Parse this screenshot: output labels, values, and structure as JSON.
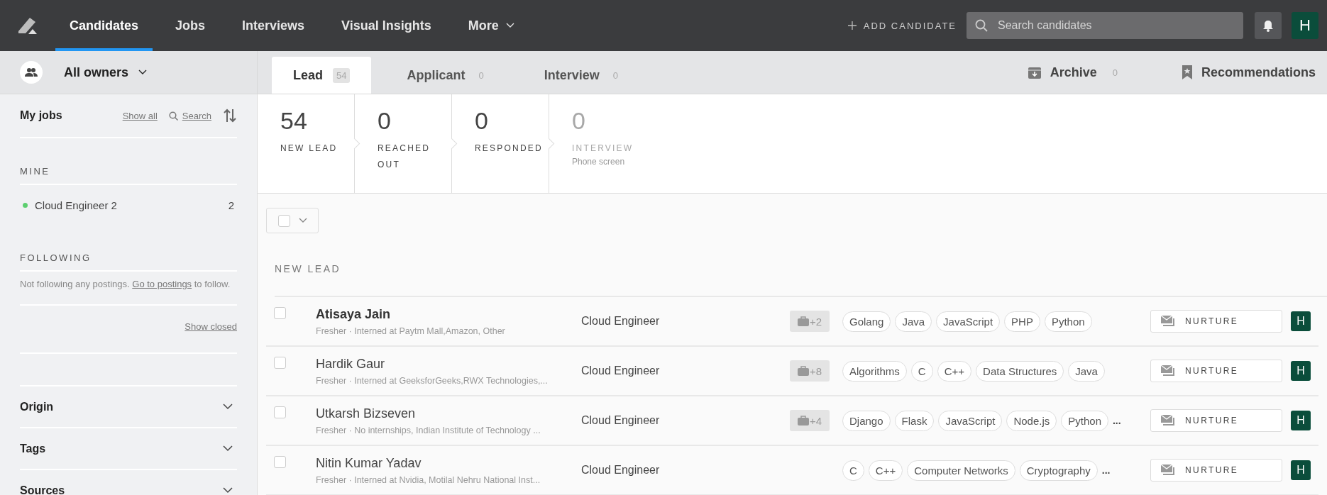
{
  "nav": {
    "items": [
      {
        "label": "Candidates",
        "selected": true
      },
      {
        "label": "Jobs",
        "selected": false
      },
      {
        "label": "Interviews",
        "selected": false
      },
      {
        "label": "Visual Insights",
        "selected": false
      },
      {
        "label": "More",
        "selected": false,
        "dropdown": true
      }
    ],
    "add_candidate": "ADD CANDIDATE",
    "search": {
      "placeholder": "Search candidates"
    },
    "user_initial": "H"
  },
  "owner_filter": "All owners",
  "tabs": [
    {
      "label": "Lead",
      "count": "54",
      "selected": true
    },
    {
      "label": "Applicant",
      "count": "0",
      "selected": false
    },
    {
      "label": "Interview",
      "count": "0",
      "selected": false
    }
  ],
  "archive": {
    "label": "Archive",
    "count": "0"
  },
  "recommendations": "Recommendations",
  "sidebar": {
    "title": "My jobs",
    "show_all": "Show all",
    "search": "Search",
    "mine_heading": "MINE",
    "mine": [
      {
        "name": "Cloud Engineer 2",
        "count": "2",
        "color": "#5ccf6f"
      }
    ],
    "following_heading": "FOLLOWING",
    "following_text": "Not following any postings.",
    "following_link": "Go to postings",
    "following_after": "to follow.",
    "show_closed": "Show closed",
    "filters": [
      {
        "label": "Origin",
        "expanded": false
      },
      {
        "label": "Tags",
        "expanded": false
      },
      {
        "label": "Sources",
        "expanded": false
      }
    ]
  },
  "stages": [
    {
      "count": "54",
      "label": "NEW LEAD",
      "muted": false
    },
    {
      "count": "0",
      "label": "REACHED OUT",
      "muted": false
    },
    {
      "count": "0",
      "label": "RESPONDED",
      "muted": false
    },
    {
      "count": "0",
      "label": "INTERVIEW",
      "sublabel": "Phone screen",
      "muted": true
    }
  ],
  "list_heading": "NEW LEAD",
  "rows": [
    {
      "name": "Atisaya Jain",
      "unread": true,
      "checked": false,
      "summary": "Fresher · Interned at Paytm Mall,Amazon, Other",
      "job": "Cloud Engineer",
      "extra_jobs": "+2",
      "tags": [
        "Golang",
        "Java",
        "JavaScript",
        "PHP",
        "Python"
      ],
      "action": "NURTURE",
      "owner": "H"
    },
    {
      "name": "Hardik Gaur",
      "unread": false,
      "checked": false,
      "summary": "Fresher · Interned at GeeksforGeeks,RWX Technologies,...",
      "job": "Cloud Engineer",
      "extra_jobs": "+8",
      "tags": [
        "Algorithms",
        "C",
        "C++",
        "Data Structures",
        "Java"
      ],
      "action": "NURTURE",
      "owner": "H"
    },
    {
      "name": "Utkarsh Bizseven",
      "unread": false,
      "checked": false,
      "summary": "Fresher · No internships, Indian Institute of Technology ...",
      "job": "Cloud Engineer",
      "extra_jobs": "+4",
      "tags": [
        "Django",
        "Flask",
        "JavaScript",
        "Node.js",
        "Python"
      ],
      "more_tags": "...",
      "action": "NURTURE",
      "owner": "H"
    },
    {
      "name": "Nitin Kumar Yadav",
      "unread": false,
      "checked": false,
      "summary": "Fresher · Interned at Nvidia, Motilal Nehru National Inst...",
      "job": "Cloud Engineer",
      "tags": [
        "C",
        "C++",
        "Computer Networks",
        "Cryptography"
      ],
      "more_tags": "...",
      "action": "NURTURE",
      "owner": "H"
    }
  ]
}
